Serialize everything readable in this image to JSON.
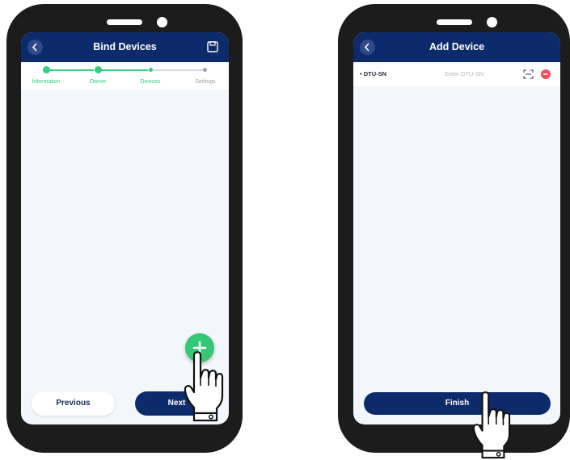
{
  "left_phone": {
    "title": "Bind Devices",
    "steps": [
      {
        "label": "Information",
        "state": "done"
      },
      {
        "label": "Owner",
        "state": "done"
      },
      {
        "label": "Devices",
        "state": "current"
      },
      {
        "label": "Settings",
        "state": "pending"
      }
    ],
    "previous_label": "Previous",
    "next_label": "Next",
    "icons": {
      "back": "back-icon",
      "save": "save-icon",
      "add": "plus-icon"
    }
  },
  "right_phone": {
    "title": "Add Device",
    "field_label": "• DTU-SN",
    "field_placeholder": "Enter DTU-SN",
    "finish_label": "Finish",
    "icons": {
      "back": "back-icon",
      "scan": "scan-icon",
      "remove": "remove-icon"
    }
  },
  "colors": {
    "header": "#0d2a6b",
    "accent_green": "#34c776",
    "remove_red": "#f04e5e",
    "phone_body": "#1c1c1c"
  }
}
